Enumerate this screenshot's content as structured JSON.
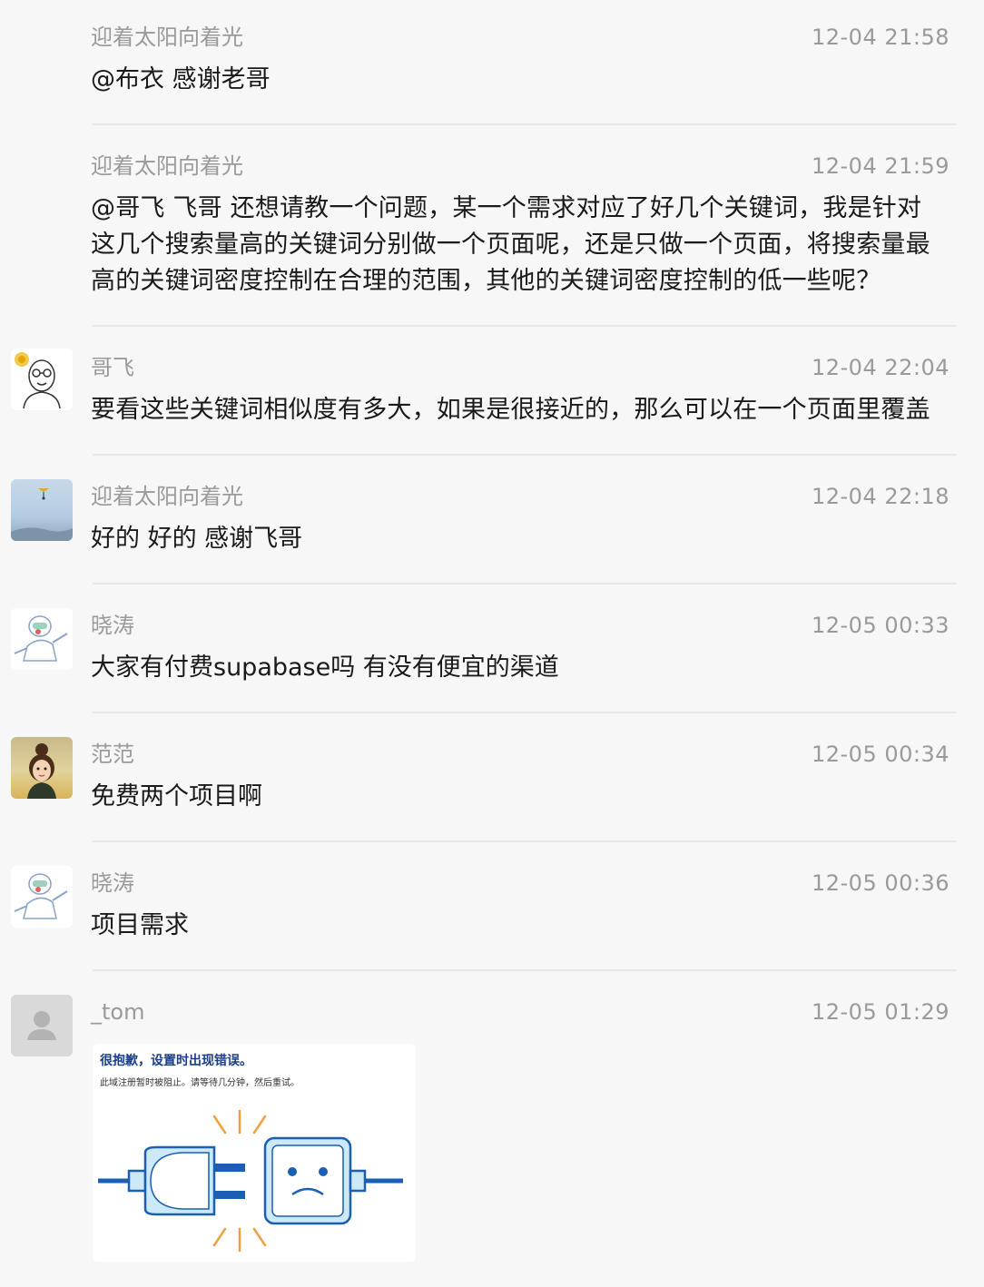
{
  "messages": [
    {
      "name": "迎着太阳向着光",
      "time": "12-04 21:58",
      "text": "@布衣 感谢老哥",
      "avatar": "none"
    },
    {
      "name": "迎着太阳向着光",
      "time": "12-04 21:59",
      "text": "@哥飞 飞哥 还想请教一个问题，某一个需求对应了好几个关键词，我是针对\n这几个搜索量高的关键词分别做一个页面呢，还是只做一个页面，将搜索量最\n高的关键词密度控制在合理的范围，其他的关键词密度控制的低一些呢？",
      "avatar": "none"
    },
    {
      "name": "哥飞",
      "time": "12-04 22:04",
      "text": "要看这些关键词相似度有多大，如果是很接近的，那么可以在一个页面里覆盖",
      "avatar": "cartoon-man-avatar"
    },
    {
      "name": "迎着太阳向着光",
      "time": "12-04 22:18",
      "text": "好的 好的 感谢飞哥",
      "avatar": "sky-photo-avatar"
    },
    {
      "name": "晓涛",
      "time": "12-05 00:33",
      "text": "大家有付费supabase吗 有没有便宜的渠道",
      "avatar": "cartoon-figure-avatar"
    },
    {
      "name": "范范",
      "time": "12-05 00:34",
      "text": "免费两个项目啊",
      "avatar": "girl-avatar"
    },
    {
      "name": "晓涛",
      "time": "12-05 00:36",
      "text": "项目需求",
      "avatar": "cartoon-figure-avatar"
    },
    {
      "name": "_tom",
      "time": "12-05 01:29",
      "text": "",
      "avatar": "default-user-avatar"
    }
  ],
  "error_image": {
    "title": "很抱歉，设置时出现错误。",
    "subtitle": "此域注册暂时被阻止。请等待几分钟，然后重试。"
  },
  "colors": {
    "background": "#f7f7f7",
    "meta_text": "#9a9a9a",
    "body_text": "#1a1a1a",
    "divider": "#e7e7e7",
    "plug_blue": "#1a5fb4",
    "spark_orange": "#f0a040"
  }
}
